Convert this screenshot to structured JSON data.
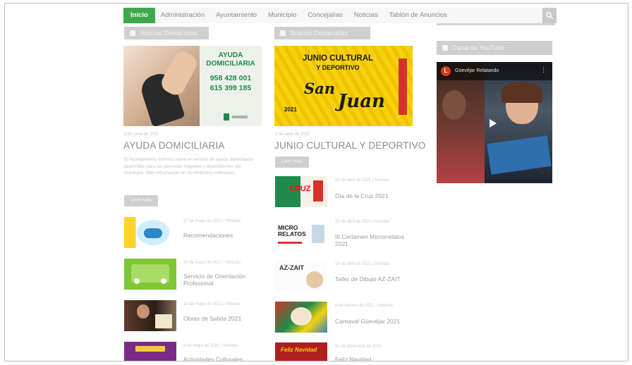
{
  "nav": {
    "items": [
      "Inicio",
      "Administración",
      "Ayuntamiento",
      "Municipio",
      "Concejalías",
      "Noticias",
      "Tablón de Anuncios"
    ]
  },
  "sections": {
    "left_header": "Noticias Destacadas",
    "center_header": "Noticias Destacadas",
    "right_header": "Canal de YouTube"
  },
  "featured_left": {
    "poster_title": "AYUDA\nDOMICILIARIA",
    "poster_phone1": "958 428 001",
    "poster_phone2": "615 399 185",
    "meta": "9 de junio de 2021",
    "title": "AYUDA DOMICILIARIA",
    "excerpt": "El Ayuntamiento informa sobre el servicio de ayuda domiciliaria disponible para las personas mayores y dependientes del municipio. Más información en los teléfonos indicados.",
    "button": "Leer más"
  },
  "featured_center": {
    "poster_line1": "JUNIO CULTURAL",
    "poster_line2": "Y DEPORTIVO",
    "poster_script1": "San",
    "poster_script2": "Juan",
    "poster_year": "2021",
    "meta": "2 de junio de 2021",
    "title": "JUNIO CULTURAL Y DEPORTIVO",
    "button": "Leer más"
  },
  "left_snippets": [
    {
      "meta": "27 de mayo de 2021 | Noticias",
      "title": "Recomendaciones"
    },
    {
      "meta": "20 de mayo de 2021 | Noticias",
      "title": "Servicio de Orientación Profesional"
    },
    {
      "meta": "13 de mayo de 2021 | Noticias",
      "title": "Obras de Salida 2021"
    },
    {
      "meta": "6 de mayo de 2021 | Noticias",
      "title": "Actividades Culturales"
    }
  ],
  "center_snippets": [
    {
      "meta": "28 de abril de 2021 | Noticias",
      "title": "Día de la Cruz 2021",
      "thumb_text": "CRUZ"
    },
    {
      "meta": "23 de abril de 2021 | Noticias",
      "title": "III Certamen Microrrelatos 2021",
      "thumb_text": "MICRO RELATOS"
    },
    {
      "meta": "15 de abril de 2021 | Noticias",
      "title": "Taller de Dibujo AZ-ZAIT",
      "thumb_text": "AZ-ZAIT"
    },
    {
      "meta": "8 de febrero de 2021 | Noticias",
      "title": "Carnaval Güevéjar 2021",
      "thumb_text": ""
    },
    {
      "meta": "10 de diciembre de 2020",
      "title": "Feliz Navidad",
      "thumb_text": "Feliz Navidad"
    }
  ],
  "video": {
    "logo": "L",
    "title": "Güevéjar Relatando"
  },
  "colors": {
    "nav_active": "#3ea94c",
    "pill_gray": "#cfcfcf",
    "poster_green": "#1f8a4c",
    "poster_yellow": "#f5d20c"
  }
}
